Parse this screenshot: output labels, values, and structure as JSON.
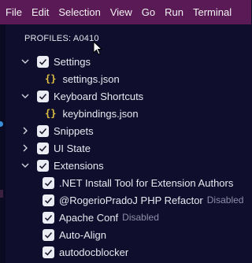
{
  "menu": [
    "File",
    "Edit",
    "Selection",
    "View",
    "Go",
    "Run",
    "Terminal"
  ],
  "profiles_title": "PROFILES: A0410",
  "tree": {
    "settings": {
      "label": "Settings",
      "child": "settings.json"
    },
    "keyboard": {
      "label": "Keyboard Shortcuts",
      "child": "keybindings.json"
    },
    "snippets": {
      "label": "Snippets"
    },
    "ui_state": {
      "label": "UI State"
    },
    "extensions": {
      "label": "Extensions",
      "items": [
        {
          "label": ".NET Install Tool for Extension Authors",
          "status": ""
        },
        {
          "label": "@RogerioPradoJ PHP Refactor",
          "status": "Disabled"
        },
        {
          "label": "Apache Conf",
          "status": "Disabled"
        },
        {
          "label": "Auto-Align",
          "status": ""
        },
        {
          "label": "autodocblocker",
          "status": ""
        }
      ]
    }
  },
  "colors": {
    "menubar": "#5a1a55",
    "background": "#0f0e2d",
    "json_icon": "#e2c244"
  }
}
